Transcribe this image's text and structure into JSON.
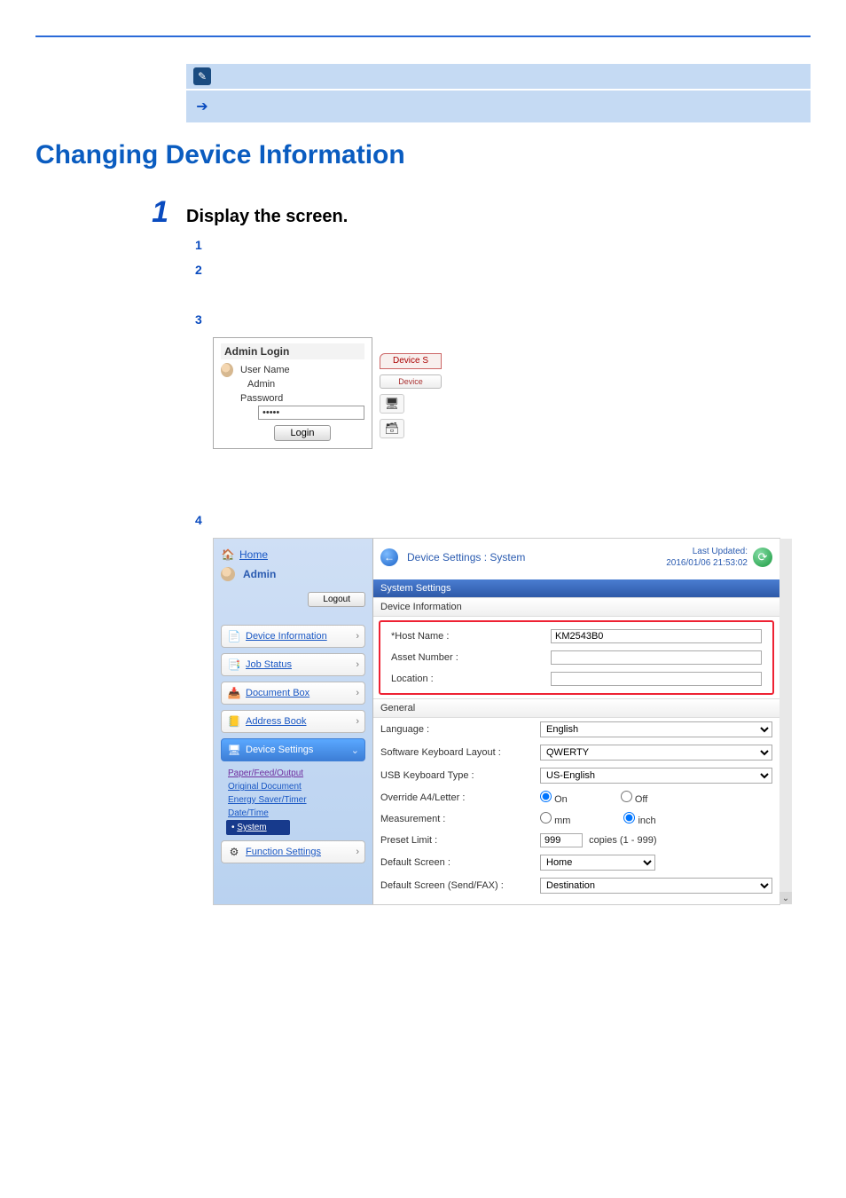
{
  "heading": "Changing Device Information",
  "step": {
    "num": "1",
    "title": "Display the screen."
  },
  "sub": {
    "n1": "1",
    "n2": "2",
    "n3": "3",
    "n4": "4"
  },
  "login": {
    "title": "Admin Login",
    "userLabel": "User Name",
    "userValue": "Admin",
    "pwdLabel": "Password",
    "pwdDots": "•••••",
    "login": "Login",
    "stubTop": "Device S",
    "stubBtn": "Device"
  },
  "embed": {
    "sidebar": {
      "home": "Home",
      "admin": "Admin",
      "logout": "Logout",
      "items": {
        "di": "Device Information",
        "js": "Job Status",
        "db": "Document Box",
        "ab": "Address Book",
        "ds": "Device Settings",
        "fs": "Function Settings"
      },
      "sub": {
        "pfo": "Paper/Feed/Output",
        "od": "Original Document",
        "est": "Energy Saver/Timer",
        "dt": "Date/Time",
        "sys": "System"
      }
    },
    "header": {
      "title": "Device Settings : System",
      "updLabel": "Last Updated:",
      "updTime": "2016/01/06 21:53:02"
    },
    "bar": "System Settings",
    "secDevice": "Device Information",
    "secGeneral": "General",
    "rows": {
      "host": {
        "k": "*Host Name :",
        "v": "KM2543B0"
      },
      "asset": {
        "k": "Asset Number :",
        "v": ""
      },
      "loc": {
        "k": "Location :",
        "v": ""
      },
      "lang": {
        "k": "Language :",
        "v": "English"
      },
      "skl": {
        "k": "Software Keyboard Layout :",
        "v": "QWERTY"
      },
      "usbk": {
        "k": "USB Keyboard Type :",
        "v": "US-English"
      },
      "oa4": {
        "k": "Override A4/Letter :",
        "on": "On",
        "off": "Off"
      },
      "meas": {
        "k": "Measurement :",
        "mm": "mm",
        "inch": "inch"
      },
      "preset": {
        "k": "Preset Limit :",
        "v": "999",
        "suffix": "copies (1 - 999)"
      },
      "defsc": {
        "k": "Default Screen :",
        "v": "Home"
      },
      "defscsf": {
        "k": "Default Screen (Send/FAX) :",
        "v": "Destination"
      }
    }
  }
}
